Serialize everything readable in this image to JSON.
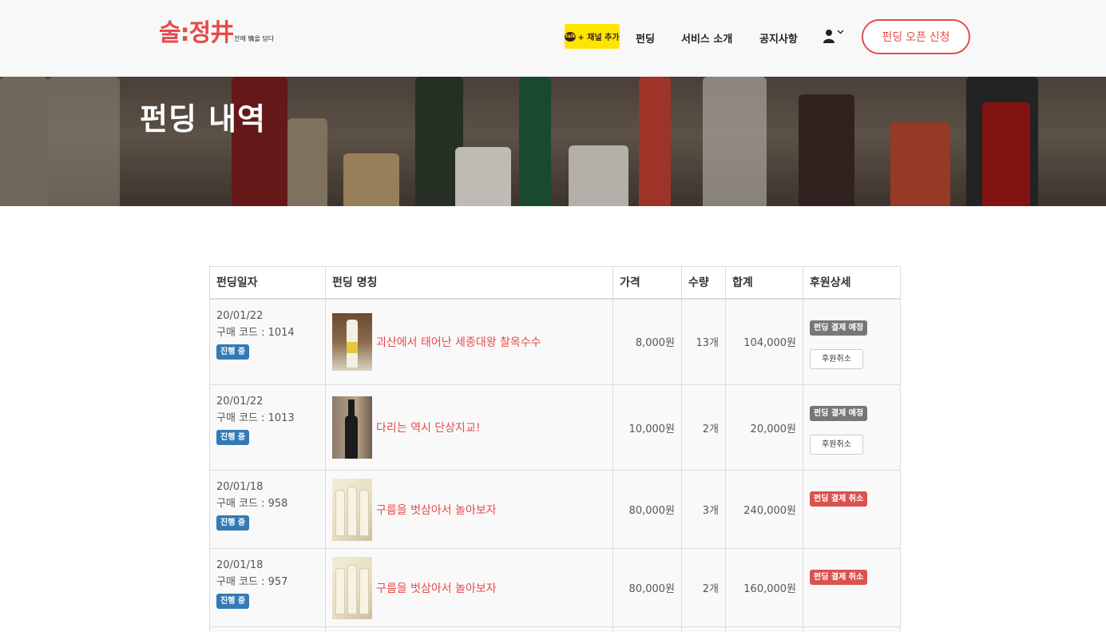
{
  "header": {
    "logo_main": "술:정井",
    "logo_sub": "잔에 情을 담다",
    "kakao_icon": "talk",
    "kakao_label": "+ 채널 추가",
    "nav": [
      "펀딩",
      "서비스 소개",
      "공지사항"
    ],
    "user_icon": "user-icon",
    "open_button": "펀딩 오픈 신청",
    "accent_color": "#e64b4b"
  },
  "banner": {
    "title": "펀딩 내역"
  },
  "table": {
    "headers": [
      "펀딩일자",
      "펀딩 명칭",
      "가격",
      "수량",
      "합계",
      "후원상세"
    ],
    "rows": [
      {
        "date": "20/01/22",
        "code": "구매 코드 : 1014",
        "status": "진행 중",
        "name": "괴산에서 태어난 세종대왕 찰옥수수",
        "price": "8,000원",
        "qty": "13개",
        "total": "104,000원",
        "payment_status": "펀딩 결제 예정",
        "payment_kind": "gray",
        "cancel_label": "후원취소"
      },
      {
        "date": "20/01/22",
        "code": "구매 코드 : 1013",
        "status": "진행 중",
        "name": "다리는 역시 단상지교!",
        "price": "10,000원",
        "qty": "2개",
        "total": "20,000원",
        "payment_status": "펀딩 결제 예정",
        "payment_kind": "gray",
        "cancel_label": "후원취소"
      },
      {
        "date": "20/01/18",
        "code": "구매 코드 : 958",
        "status": "진행 중",
        "name": "구름을 벗삼아서 놀아보자",
        "price": "80,000원",
        "qty": "3개",
        "total": "240,000원",
        "payment_status": "펀딩 결제 취소",
        "payment_kind": "red",
        "cancel_label": ""
      },
      {
        "date": "20/01/18",
        "code": "구매 코드 : 957",
        "status": "진행 중",
        "name": "구름을 벗삼아서 놀아보자",
        "price": "80,000원",
        "qty": "2개",
        "total": "160,000원",
        "payment_status": "펀딩 결제 취소",
        "payment_kind": "red",
        "cancel_label": ""
      }
    ]
  }
}
